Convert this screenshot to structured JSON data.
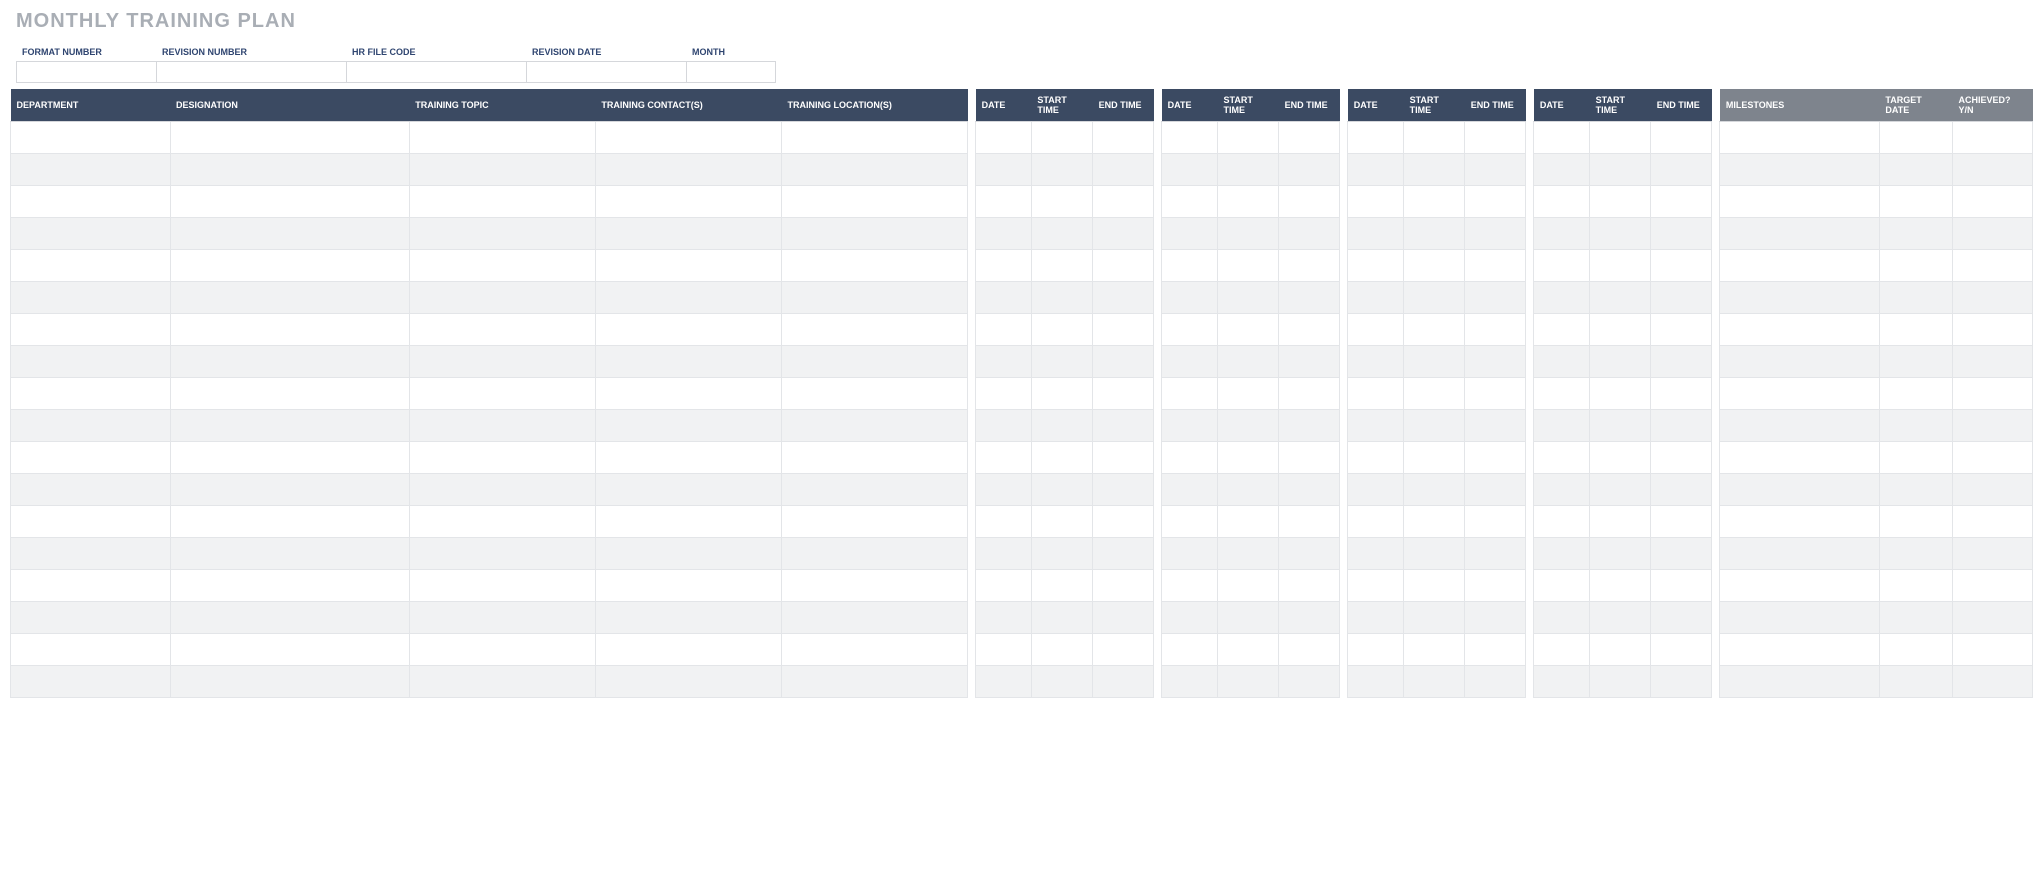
{
  "title": "MONTHLY TRAINING PLAN",
  "meta": {
    "labels": {
      "format_number": "FORMAT NUMBER",
      "revision_number": "REVISION NUMBER",
      "hr_file_code": "HR FILE CODE",
      "revision_date": "REVISION DATE",
      "month": "MONTH"
    },
    "values": {
      "format_number": "",
      "revision_number": "",
      "hr_file_code": "",
      "revision_date": "",
      "month": ""
    }
  },
  "columns": {
    "department": "DEPARTMENT",
    "designation": "DESIGNATION",
    "training_topic": "TRAINING TOPIC",
    "training_contacts": "TRAINING CONTACT(S)",
    "training_locations": "TRAINING LOCATION(S)",
    "date": "DATE",
    "start_time": "START TIME",
    "end_time": "END TIME",
    "milestones": "MILESTONES",
    "target_date": "TARGET DATE",
    "achieved": "ACHIEVED? Y/N"
  },
  "week_groups": 4,
  "rows": [
    {
      "department": "",
      "designation": "",
      "training_topic": "",
      "training_contacts": "",
      "training_locations": "",
      "weeks": [
        {
          "date": "",
          "start_time": "",
          "end_time": ""
        },
        {
          "date": "",
          "start_time": "",
          "end_time": ""
        },
        {
          "date": "",
          "start_time": "",
          "end_time": ""
        },
        {
          "date": "",
          "start_time": "",
          "end_time": ""
        }
      ],
      "milestones": "",
      "target_date": "",
      "achieved": ""
    },
    {
      "department": "",
      "designation": "",
      "training_topic": "",
      "training_contacts": "",
      "training_locations": "",
      "weeks": [
        {
          "date": "",
          "start_time": "",
          "end_time": ""
        },
        {
          "date": "",
          "start_time": "",
          "end_time": ""
        },
        {
          "date": "",
          "start_time": "",
          "end_time": ""
        },
        {
          "date": "",
          "start_time": "",
          "end_time": ""
        }
      ],
      "milestones": "",
      "target_date": "",
      "achieved": ""
    },
    {
      "department": "",
      "designation": "",
      "training_topic": "",
      "training_contacts": "",
      "training_locations": "",
      "weeks": [
        {
          "date": "",
          "start_time": "",
          "end_time": ""
        },
        {
          "date": "",
          "start_time": "",
          "end_time": ""
        },
        {
          "date": "",
          "start_time": "",
          "end_time": ""
        },
        {
          "date": "",
          "start_time": "",
          "end_time": ""
        }
      ],
      "milestones": "",
      "target_date": "",
      "achieved": ""
    },
    {
      "department": "",
      "designation": "",
      "training_topic": "",
      "training_contacts": "",
      "training_locations": "",
      "weeks": [
        {
          "date": "",
          "start_time": "",
          "end_time": ""
        },
        {
          "date": "",
          "start_time": "",
          "end_time": ""
        },
        {
          "date": "",
          "start_time": "",
          "end_time": ""
        },
        {
          "date": "",
          "start_time": "",
          "end_time": ""
        }
      ],
      "milestones": "",
      "target_date": "",
      "achieved": ""
    },
    {
      "department": "",
      "designation": "",
      "training_topic": "",
      "training_contacts": "",
      "training_locations": "",
      "weeks": [
        {
          "date": "",
          "start_time": "",
          "end_time": ""
        },
        {
          "date": "",
          "start_time": "",
          "end_time": ""
        },
        {
          "date": "",
          "start_time": "",
          "end_time": ""
        },
        {
          "date": "",
          "start_time": "",
          "end_time": ""
        }
      ],
      "milestones": "",
      "target_date": "",
      "achieved": ""
    },
    {
      "department": "",
      "designation": "",
      "training_topic": "",
      "training_contacts": "",
      "training_locations": "",
      "weeks": [
        {
          "date": "",
          "start_time": "",
          "end_time": ""
        },
        {
          "date": "",
          "start_time": "",
          "end_time": ""
        },
        {
          "date": "",
          "start_time": "",
          "end_time": ""
        },
        {
          "date": "",
          "start_time": "",
          "end_time": ""
        }
      ],
      "milestones": "",
      "target_date": "",
      "achieved": ""
    },
    {
      "department": "",
      "designation": "",
      "training_topic": "",
      "training_contacts": "",
      "training_locations": "",
      "weeks": [
        {
          "date": "",
          "start_time": "",
          "end_time": ""
        },
        {
          "date": "",
          "start_time": "",
          "end_time": ""
        },
        {
          "date": "",
          "start_time": "",
          "end_time": ""
        },
        {
          "date": "",
          "start_time": "",
          "end_time": ""
        }
      ],
      "milestones": "",
      "target_date": "",
      "achieved": ""
    },
    {
      "department": "",
      "designation": "",
      "training_topic": "",
      "training_contacts": "",
      "training_locations": "",
      "weeks": [
        {
          "date": "",
          "start_time": "",
          "end_time": ""
        },
        {
          "date": "",
          "start_time": "",
          "end_time": ""
        },
        {
          "date": "",
          "start_time": "",
          "end_time": ""
        },
        {
          "date": "",
          "start_time": "",
          "end_time": ""
        }
      ],
      "milestones": "",
      "target_date": "",
      "achieved": ""
    },
    {
      "department": "",
      "designation": "",
      "training_topic": "",
      "training_contacts": "",
      "training_locations": "",
      "weeks": [
        {
          "date": "",
          "start_time": "",
          "end_time": ""
        },
        {
          "date": "",
          "start_time": "",
          "end_time": ""
        },
        {
          "date": "",
          "start_time": "",
          "end_time": ""
        },
        {
          "date": "",
          "start_time": "",
          "end_time": ""
        }
      ],
      "milestones": "",
      "target_date": "",
      "achieved": ""
    },
    {
      "department": "",
      "designation": "",
      "training_topic": "",
      "training_contacts": "",
      "training_locations": "",
      "weeks": [
        {
          "date": "",
          "start_time": "",
          "end_time": ""
        },
        {
          "date": "",
          "start_time": "",
          "end_time": ""
        },
        {
          "date": "",
          "start_time": "",
          "end_time": ""
        },
        {
          "date": "",
          "start_time": "",
          "end_time": ""
        }
      ],
      "milestones": "",
      "target_date": "",
      "achieved": ""
    },
    {
      "department": "",
      "designation": "",
      "training_topic": "",
      "training_contacts": "",
      "training_locations": "",
      "weeks": [
        {
          "date": "",
          "start_time": "",
          "end_time": ""
        },
        {
          "date": "",
          "start_time": "",
          "end_time": ""
        },
        {
          "date": "",
          "start_time": "",
          "end_time": ""
        },
        {
          "date": "",
          "start_time": "",
          "end_time": ""
        }
      ],
      "milestones": "",
      "target_date": "",
      "achieved": ""
    },
    {
      "department": "",
      "designation": "",
      "training_topic": "",
      "training_contacts": "",
      "training_locations": "",
      "weeks": [
        {
          "date": "",
          "start_time": "",
          "end_time": ""
        },
        {
          "date": "",
          "start_time": "",
          "end_time": ""
        },
        {
          "date": "",
          "start_time": "",
          "end_time": ""
        },
        {
          "date": "",
          "start_time": "",
          "end_time": ""
        }
      ],
      "milestones": "",
      "target_date": "",
      "achieved": ""
    },
    {
      "department": "",
      "designation": "",
      "training_topic": "",
      "training_contacts": "",
      "training_locations": "",
      "weeks": [
        {
          "date": "",
          "start_time": "",
          "end_time": ""
        },
        {
          "date": "",
          "start_time": "",
          "end_time": ""
        },
        {
          "date": "",
          "start_time": "",
          "end_time": ""
        },
        {
          "date": "",
          "start_time": "",
          "end_time": ""
        }
      ],
      "milestones": "",
      "target_date": "",
      "achieved": ""
    },
    {
      "department": "",
      "designation": "",
      "training_topic": "",
      "training_contacts": "",
      "training_locations": "",
      "weeks": [
        {
          "date": "",
          "start_time": "",
          "end_time": ""
        },
        {
          "date": "",
          "start_time": "",
          "end_time": ""
        },
        {
          "date": "",
          "start_time": "",
          "end_time": ""
        },
        {
          "date": "",
          "start_time": "",
          "end_time": ""
        }
      ],
      "milestones": "",
      "target_date": "",
      "achieved": ""
    },
    {
      "department": "",
      "designation": "",
      "training_topic": "",
      "training_contacts": "",
      "training_locations": "",
      "weeks": [
        {
          "date": "",
          "start_time": "",
          "end_time": ""
        },
        {
          "date": "",
          "start_time": "",
          "end_time": ""
        },
        {
          "date": "",
          "start_time": "",
          "end_time": ""
        },
        {
          "date": "",
          "start_time": "",
          "end_time": ""
        }
      ],
      "milestones": "",
      "target_date": "",
      "achieved": ""
    },
    {
      "department": "",
      "designation": "",
      "training_topic": "",
      "training_contacts": "",
      "training_locations": "",
      "weeks": [
        {
          "date": "",
          "start_time": "",
          "end_time": ""
        },
        {
          "date": "",
          "start_time": "",
          "end_time": ""
        },
        {
          "date": "",
          "start_time": "",
          "end_time": ""
        },
        {
          "date": "",
          "start_time": "",
          "end_time": ""
        }
      ],
      "milestones": "",
      "target_date": "",
      "achieved": ""
    },
    {
      "department": "",
      "designation": "",
      "training_topic": "",
      "training_contacts": "",
      "training_locations": "",
      "weeks": [
        {
          "date": "",
          "start_time": "",
          "end_time": ""
        },
        {
          "date": "",
          "start_time": "",
          "end_time": ""
        },
        {
          "date": "",
          "start_time": "",
          "end_time": ""
        },
        {
          "date": "",
          "start_time": "",
          "end_time": ""
        }
      ],
      "milestones": "",
      "target_date": "",
      "achieved": ""
    },
    {
      "department": "",
      "designation": "",
      "training_topic": "",
      "training_contacts": "",
      "training_locations": "",
      "weeks": [
        {
          "date": "",
          "start_time": "",
          "end_time": ""
        },
        {
          "date": "",
          "start_time": "",
          "end_time": ""
        },
        {
          "date": "",
          "start_time": "",
          "end_time": ""
        },
        {
          "date": "",
          "start_time": "",
          "end_time": ""
        }
      ],
      "milestones": "",
      "target_date": "",
      "achieved": ""
    }
  ]
}
